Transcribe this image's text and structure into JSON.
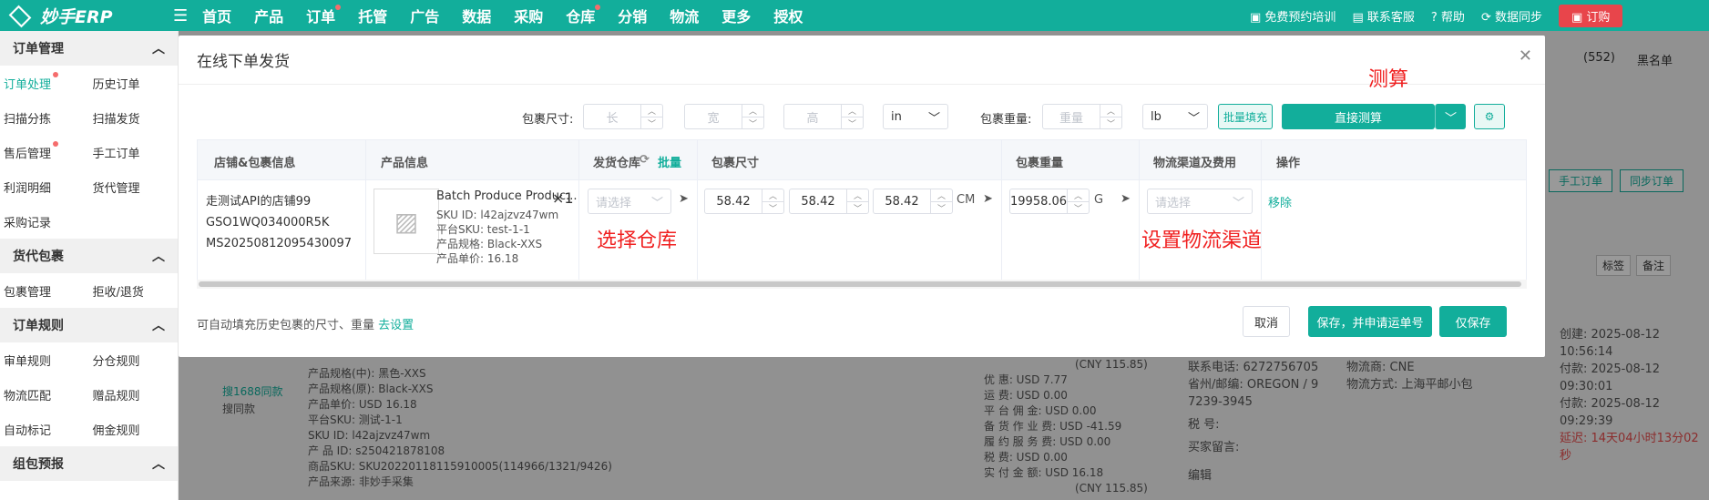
{
  "app": {
    "logo": "妙手ERP",
    "nav": [
      "首页",
      "产品",
      "订单",
      "托管",
      "广告",
      "数据",
      "采购",
      "仓库",
      "分销",
      "物流",
      "更多",
      "授权"
    ],
    "top_right": [
      "免费预约培训",
      "联系客服",
      "帮助",
      "数据同步"
    ],
    "order_btn": "订购"
  },
  "sidebar": {
    "groups": [
      {
        "title": "订单管理",
        "rows": [
          [
            "订单处理",
            "历史订单"
          ],
          [
            "扫描分拣",
            "扫描发货"
          ],
          [
            "售后管理",
            "手工订单"
          ],
          [
            "利润明细",
            "货代管理"
          ],
          [
            "采购记录",
            ""
          ]
        ]
      },
      {
        "title": "货代包裹",
        "rows": [
          [
            "包裹管理",
            "拒收/退货"
          ]
        ]
      },
      {
        "title": "订单规则",
        "rows": [
          [
            "审单规则",
            "分仓规则"
          ],
          [
            "物流匹配",
            "赠品规则"
          ],
          [
            "自动标记",
            "佣金规则"
          ]
        ]
      },
      {
        "title": "组包预报",
        "rows": []
      }
    ]
  },
  "background": {
    "top_right": [
      "(552)",
      "黑名单"
    ],
    "buttons": [
      "手工订单",
      "同步订单"
    ],
    "tags": [
      "标签",
      "备注"
    ],
    "product_lines": [
      "产品规格(中): 黑色-XXS",
      "产品规格(原): Black-XXS",
      "产品单价: USD 16.18",
      "平台SKU: 测试-1-1",
      "SKU ID: l42ajzvz47wm",
      "产 品 ID: s250421878108",
      "商品SKU: SKU20220118115910005(114966/1321/9426)",
      "产品来源: 非妙手采集"
    ],
    "search_links": [
      "搜1688同款",
      "搜同款"
    ],
    "fee_lines": [
      "(CNY 115.85)",
      "优 惠: USD 7.77",
      "运 费: USD 0.00",
      "平 台 佣 金: USD 0.00",
      "备 货 作 业 费: USD -41.59",
      "履 约 服 务 费: USD 0.00",
      "税 费: USD 0.00",
      "实 付 金 额: USD 16.18",
      "(CNY 115.85)"
    ],
    "contact_lines": [
      "联系电话: 6272756705",
      "省州/邮编: OREGON / 9",
      "7239-3945",
      "税 号:",
      "买家留言:",
      "编辑"
    ],
    "logistics_lines": [
      "物流商: CNE",
      "物流方式: 上海平邮小包"
    ],
    "time_lines": [
      "创建: 2025-08-12 10:56:14",
      "付款: 2025-08-12 09:30:01",
      "付款: 2025-08-12 09:29:39",
      "延迟: 14天04小时13分02秒"
    ]
  },
  "modal": {
    "title": "在线下单发货",
    "pkg_size_label": "包裹尺寸:",
    "length_ph": "长",
    "width_ph": "宽",
    "height_ph": "高",
    "size_unit": "in",
    "pkg_weight_label": "包裹重量:",
    "weight_ph": "重量",
    "weight_unit": "lb",
    "batch_fill": "批量填充",
    "measure": "直接测算",
    "annot_measure": "测算",
    "columns": [
      "店铺&包裹信息",
      "产品信息",
      "发货仓库",
      "批量",
      "包裹尺寸",
      "包裹重量",
      "物流渠道及费用",
      "操作"
    ],
    "row": {
      "shop": "走测试API的店铺99",
      "package_no": "GSO1WQ034000R5K",
      "order_no": "MS20250812095430097",
      "product_name": "Batch Produce Produc...",
      "qty": "×1",
      "sku_id": "SKU ID:  l42ajzvz47wm",
      "platform_sku": "平台SKU:  test-1-1",
      "spec": "产品规格:  Black-XXS",
      "price": "产品单价:  16.18",
      "warehouse_ph": "请选择",
      "annot_warehouse": "选择仓库",
      "dim_l": "58.42",
      "dim_w": "58.42",
      "dim_h": "58.42",
      "dim_unit": "CM",
      "weight": "19958.06",
      "weight_unit": "G",
      "channel_ph": "请选择",
      "annot_channel": "设置物流渠道",
      "action": "移除"
    },
    "footer_note": "可自动填充历史包裹的尺寸、重量",
    "footer_link": "去设置",
    "cancel": "取消",
    "save_apply": "保存，并申请运单号",
    "save_only": "仅保存"
  },
  "colors": {
    "brand": "#12ae9b",
    "red": "#f02020"
  }
}
